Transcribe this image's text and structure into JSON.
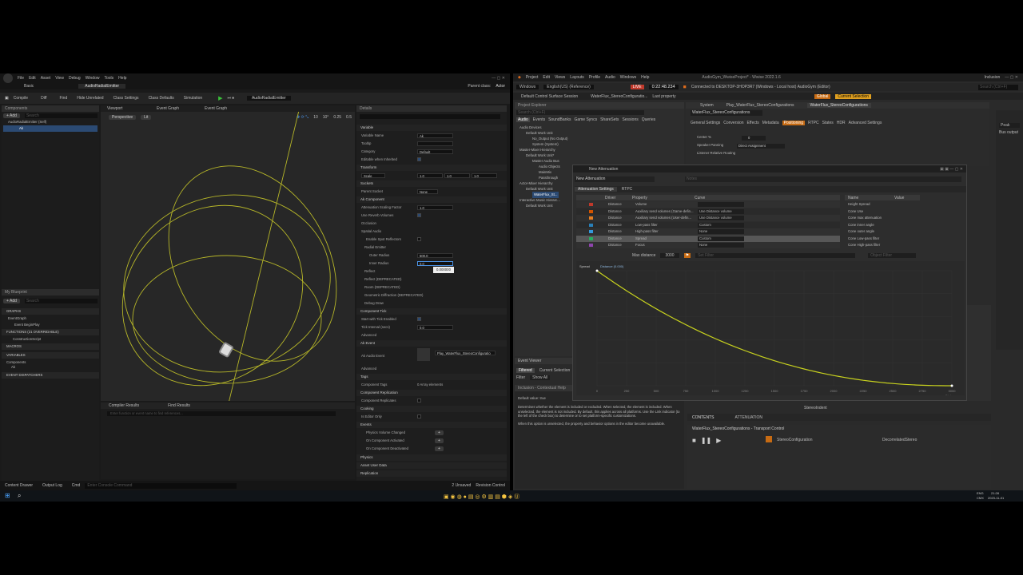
{
  "ue": {
    "menus": [
      "File",
      "Edit",
      "Asset",
      "View",
      "Debug",
      "Window",
      "Tools",
      "Help"
    ],
    "tab_basic": "Basic",
    "tab_asset": "AudioRadialEmitter",
    "parent_class_label": "Parent class:",
    "parent_class_value": "Actor",
    "toolbar": [
      "Compile",
      "Diff",
      "Find",
      "Hide Unrelated",
      "Class Settings",
      "Class Defaults",
      "Simulation"
    ],
    "debug_dropdown": "AudioRadialEmitter",
    "components_title": "Components",
    "add_label": "+ Add",
    "search_placeholder": "Search",
    "comp_root": "AudioRadialEmitter (Self)",
    "comp_child": "Ak",
    "viewport_tabs": [
      "Viewport",
      "Event Graph",
      "Event Graph"
    ],
    "perspective": "Perspective",
    "lit": "Lit",
    "vp_values": [
      "10",
      "10°",
      "0.25",
      "0.5"
    ],
    "details_title": "Details",
    "variable_section": "Variable",
    "var_rows": [
      {
        "label": "Variable Name",
        "value": "Ak"
      },
      {
        "label": "Tooltip",
        "value": ""
      },
      {
        "label": "Category",
        "value": "Default"
      },
      {
        "label": "Editable when Inherited",
        "value": ""
      }
    ],
    "transform_section": "Transform",
    "scale_label": "Scale",
    "scale_values": [
      "1.0",
      "1.0",
      "1.0"
    ],
    "sockets_section": "Sockets",
    "parent_socket_label": "Parent Socket",
    "parent_socket_value": "None",
    "akcomp_section": "Ak Component",
    "atten_label": "Attenuation Scaling Factor",
    "atten_value": "1.0",
    "reverb_label": "Use Reverb Volumes",
    "occlusion": "Occlusion",
    "spatial": "Spatial Audio",
    "spot_refl": "Enable Spot Reflectors",
    "radial": "Radial Emitter",
    "outer_label": "Outer Radius",
    "outer_value": "500.0",
    "inner_label": "Inner Radius",
    "inner_value": "0.0",
    "tooltip_value": "0.000000",
    "collapsed_rows": [
      "Reflect",
      "Reflect (DEPRECATED)",
      "Room (DEPRECATED)",
      "Geometric Diffraction (DEPRECATED)",
      "Debug Draw"
    ],
    "tick_section": "Component Tick",
    "tick_start": "Start with Tick Enabled",
    "tick_interval": "Tick Interval (secs)",
    "tick_value": "0.0",
    "advanced": "Advanced",
    "akevent_section": "Ak Event",
    "ak_audio_event_label": "Ak Audio Event",
    "ak_audio_event_value": "Play_WaterFlux_StereoConfiguratio",
    "advanced2": "Advanced",
    "tags_section": "Tags",
    "component_tags": "Component Tags",
    "component_tags_value": "0 Array elements",
    "replication_section": "Component Replication",
    "comp_replicates": "Component Replicates",
    "cooking_section": "Cooking",
    "editor_only": "Is Editor Only",
    "events_section": "Events",
    "event_rows": [
      "Physics Volume Changed",
      "On Component Activated",
      "On Component Deactivated"
    ],
    "physics": "Physics",
    "asset_user_data": "Asset User Data",
    "replication": "Replication",
    "my_blueprint": "My Blueprint",
    "bp_rows": [
      "GRAPHS",
      "EventGraph",
      "Event BeginPlay",
      "FUNCTIONS (21 OVERRIDABLE)",
      "ConstructionScript",
      "MACROS",
      "VARIABLES",
      "Components",
      "Ak",
      "EVENT DISPATCHERS"
    ],
    "compiler_results": "Compiler Results",
    "find_results": "Find Results",
    "find_placeholder": "Enter function or event name to find references...",
    "status_bar": [
      "Content Drawer",
      "Output Log",
      "Cmd",
      "Enter Console Command"
    ],
    "status_right": [
      "2 Unsaved",
      "Revision Control"
    ]
  },
  "wwise": {
    "title": "AudioGym_WwiseProject* - Wwise 2022.1.6",
    "menus": [
      "Project",
      "Edit",
      "Views",
      "Layouts",
      "Profile",
      "Audio",
      "Windows",
      "Help"
    ],
    "user": "Inclusion",
    "layout": "Windows",
    "platform": "English(US) (Reference)",
    "live": "LIVE",
    "time": "0:22:48.234",
    "connected": "Connected to DESKTOP-3HOP3R7 (Windows - Local host) AudioGym (Editor)",
    "search_placeholder": "Search (Ctrl+F)",
    "session_tab": "Default Control Surface Session",
    "event_tab": "WaterFlux_StereoConfiguratio...",
    "last_property": "Last property",
    "global_btn": "Global",
    "selection_btn": "Current Selection",
    "project_explorer": "Project Explorer",
    "pe_tabs": [
      "Audio",
      "Events",
      "SoundBanks",
      "Game Syncs",
      "ShareSets",
      "Sessions",
      "Queries"
    ],
    "tree": [
      "Audio Devices",
      "Default Work Unit",
      "No_Output (No Output)",
      "System (System)",
      "Master-Mixer Hierarchy",
      "Default Work Unit*",
      "Master Audio Bus",
      "Audio Objects",
      "MainMix",
      "Passthrough",
      "Actor-Mixer Hierarchy",
      "Default Work Unit",
      "WaterFlux_St...",
      "Interactive Music Hierarc...",
      "Default Work Unit"
    ],
    "editor_tabs": [
      "System",
      "Play_WaterFlux_StereoConfigurations",
      "WaterFlux_StereoConfigurations"
    ],
    "object_name": "WaterFlux_StereoConfigurations",
    "ed_tabs": [
      "General Settings",
      "Conversion",
      "Effects",
      "Metadata",
      "Positioning",
      "RTPC",
      "States",
      "HDR",
      "Advanced Settings"
    ],
    "center_label": "Center %",
    "center_value": "0",
    "panning_label": "Speaker Panning",
    "panning_value": "Direct Assignment",
    "listener_label": "Listener Relative Routing",
    "peak": "Peak",
    "bus_output": "Bus output",
    "atten_window": "New Attenuation",
    "atten_name": "New Attenuation",
    "notes": "Notes",
    "atten_tabs": [
      "Attenuation Settings",
      "RTPC"
    ],
    "grid_headers": [
      "Driver",
      "Property",
      "Curve"
    ],
    "grid_rows": [
      {
        "driver": "Distance",
        "property": "Volume",
        "curve": "",
        "color": "#c0392b"
      },
      {
        "driver": "Distance",
        "property": "Auxiliary send volumes (Game-defin...",
        "curve": "Use Distance volume",
        "color": "#d35400"
      },
      {
        "driver": "Distance",
        "property": "Auxiliary send volumes (User-defin...",
        "curve": "Use Distance volume",
        "color": "#e67e22"
      },
      {
        "driver": "Distance",
        "property": "Low-pass filter",
        "curve": "Custom",
        "color": "#2980b9"
      },
      {
        "driver": "Distance",
        "property": "High-pass filter",
        "curve": "None",
        "color": "#3498db"
      },
      {
        "driver": "Distance",
        "property": "Spread",
        "curve": "Custom",
        "color": "#27ae60"
      },
      {
        "driver": "Distance",
        "property": "Focus",
        "curve": "None",
        "color": "#8e44ad"
      }
    ],
    "prop_headers": [
      "Name",
      "Value"
    ],
    "prop_rows": [
      "Height Spread",
      "Cone Use",
      "Cone max attenuation",
      "Cone inner angle",
      "Cone outer angle",
      "Cone Low-pass filter",
      "Cone High-pass filter"
    ],
    "max_distance_label": "Max distance",
    "max_distance_value": "3000",
    "set_filter": "Set Filter",
    "object_filter": "Object Filter",
    "curve_label": "Spread",
    "curve_sel": "Distance (0.000)",
    "x_ticks": [
      "0",
      "250",
      "500",
      "750",
      "1000",
      "1250",
      "1500",
      "1750",
      "2000",
      "2250",
      "2500",
      "2750",
      "3000"
    ],
    "x_label": "Distance",
    "event_viewer": "Event Viewer",
    "ev_filters": [
      "Filtered",
      "Current Selection"
    ],
    "filter_label": "Filter",
    "show_all": "Show All",
    "help_title": "Inclusion - Contextual Help",
    "help_default": "Default value: true",
    "help_text1": "Determines whether the element is included or excluded. When selected, the element is included. When unselected, the element is not included. By default, this applies across all platforms. Use the Link indicator (to the left of the check box) to determine or to set platform-specific customizations.",
    "help_text2": "When this option is unselected, the property and behavior options in the editor become unavailable.",
    "stereo_side": "StereoIndent",
    "contents_tabs": [
      "CONTENTS",
      "ATTENUATION"
    ],
    "transport_title": "WaterFlux_StereoConfigurations - Transport Control",
    "transport_item": "StereoConfiguration",
    "transport_item_value": "DecorrelatedStereo"
  },
  "taskbar": {
    "time": "21:28",
    "date": "2023-11-01",
    "lang": "ENG",
    "sub": "CMX"
  }
}
